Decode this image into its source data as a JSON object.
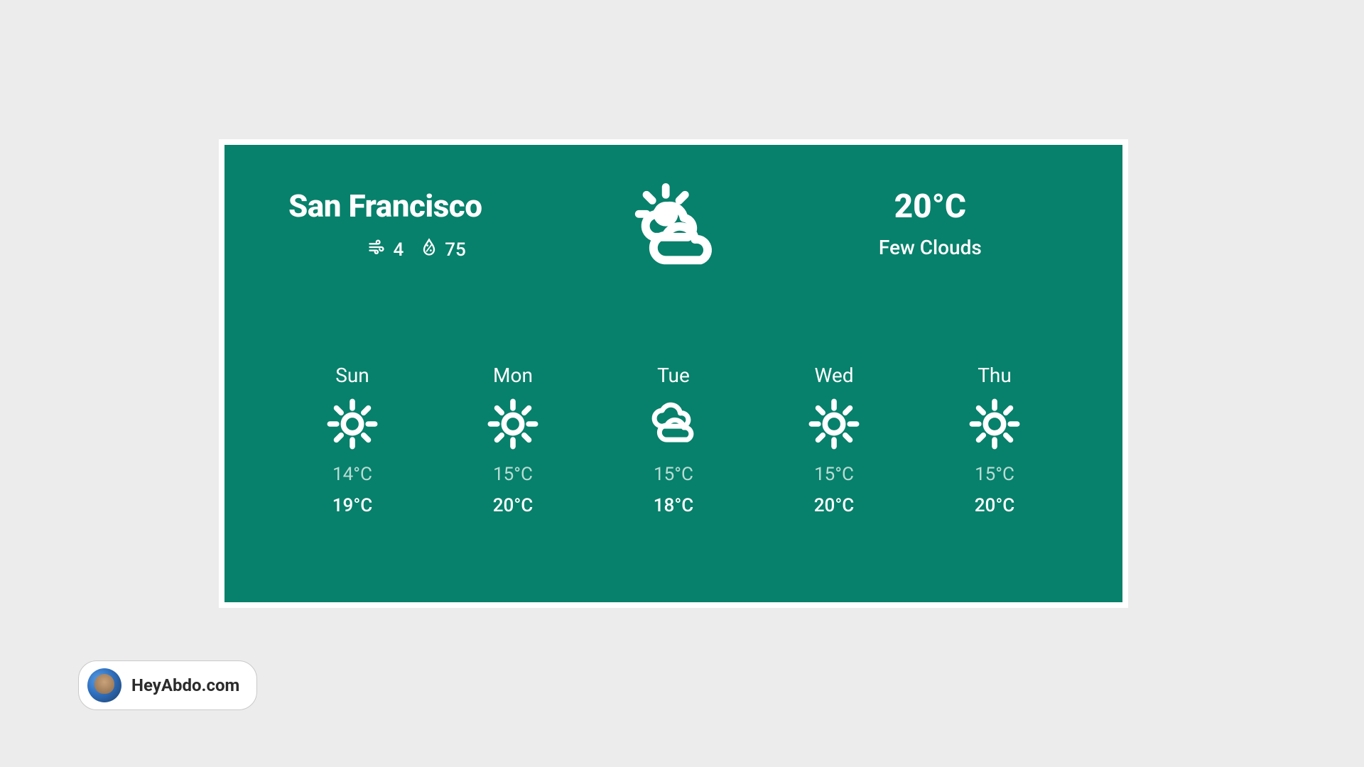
{
  "weather": {
    "city": "San Francisco",
    "wind": "4",
    "humidity": "75",
    "temperature": "20°C",
    "condition": "Few Clouds",
    "main_icon": "partly-cloudy"
  },
  "forecast": [
    {
      "day": "Sun",
      "icon": "sun",
      "low": "14°C",
      "high": "19°C"
    },
    {
      "day": "Mon",
      "icon": "sun",
      "low": "15°C",
      "high": "20°C"
    },
    {
      "day": "Tue",
      "icon": "clouds",
      "low": "15°C",
      "high": "18°C"
    },
    {
      "day": "Wed",
      "icon": "sun",
      "low": "15°C",
      "high": "20°C"
    },
    {
      "day": "Thu",
      "icon": "sun",
      "low": "15°C",
      "high": "20°C"
    }
  ],
  "badge": {
    "label": "HeyAbdo.com"
  },
  "colors": {
    "card_bg": "#07816b",
    "page_bg": "#ececec"
  }
}
